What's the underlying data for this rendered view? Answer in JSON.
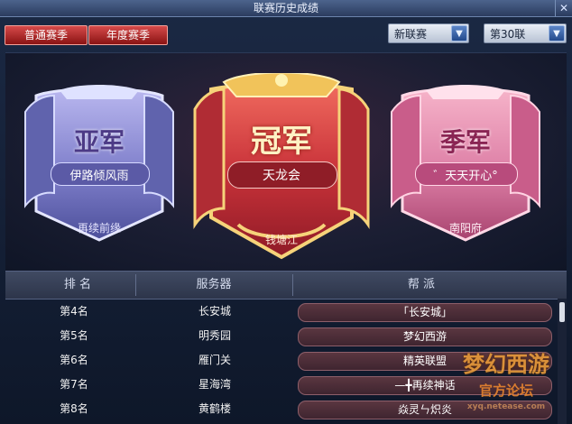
{
  "window": {
    "title": "联赛历史成绩"
  },
  "tabs": {
    "normal": "普通赛季",
    "annual": "年度赛季"
  },
  "filters": {
    "league": "新联赛",
    "season": "第30联"
  },
  "podium": {
    "second": {
      "rank_label": "亚军",
      "team": "伊路倾风雨",
      "server": "再续前缘"
    },
    "first": {
      "rank_label": "冠军",
      "team": "天龙会",
      "server": "钱塘江"
    },
    "third": {
      "rank_label": "季军",
      "team": "゛天天开心°",
      "server": "南阳府"
    }
  },
  "table": {
    "headers": {
      "rank": "排  名",
      "server": "服务器",
      "guild": "帮  派"
    },
    "rows": [
      {
        "rank": "第4名",
        "server": "长安城",
        "guild": "「长安城」"
      },
      {
        "rank": "第5名",
        "server": "明秀园",
        "guild": "梦幻西游"
      },
      {
        "rank": "第6名",
        "server": "雁门关",
        "guild": "精英联盟"
      },
      {
        "rank": "第7名",
        "server": "星海湾",
        "guild": "—╋再续神话"
      },
      {
        "rank": "第8名",
        "server": "黄鹤楼",
        "guild": "焱灵ㄣ炽炎"
      }
    ]
  },
  "watermark": {
    "line1": "梦幻西游",
    "line2": "官方论坛",
    "url": "xyq.netease.com"
  },
  "colors": {
    "gold": "#f1c35a",
    "silver_banner": "#8e8ed4",
    "red_banner": "#c8343b",
    "pink_banner": "#e48ab4"
  }
}
